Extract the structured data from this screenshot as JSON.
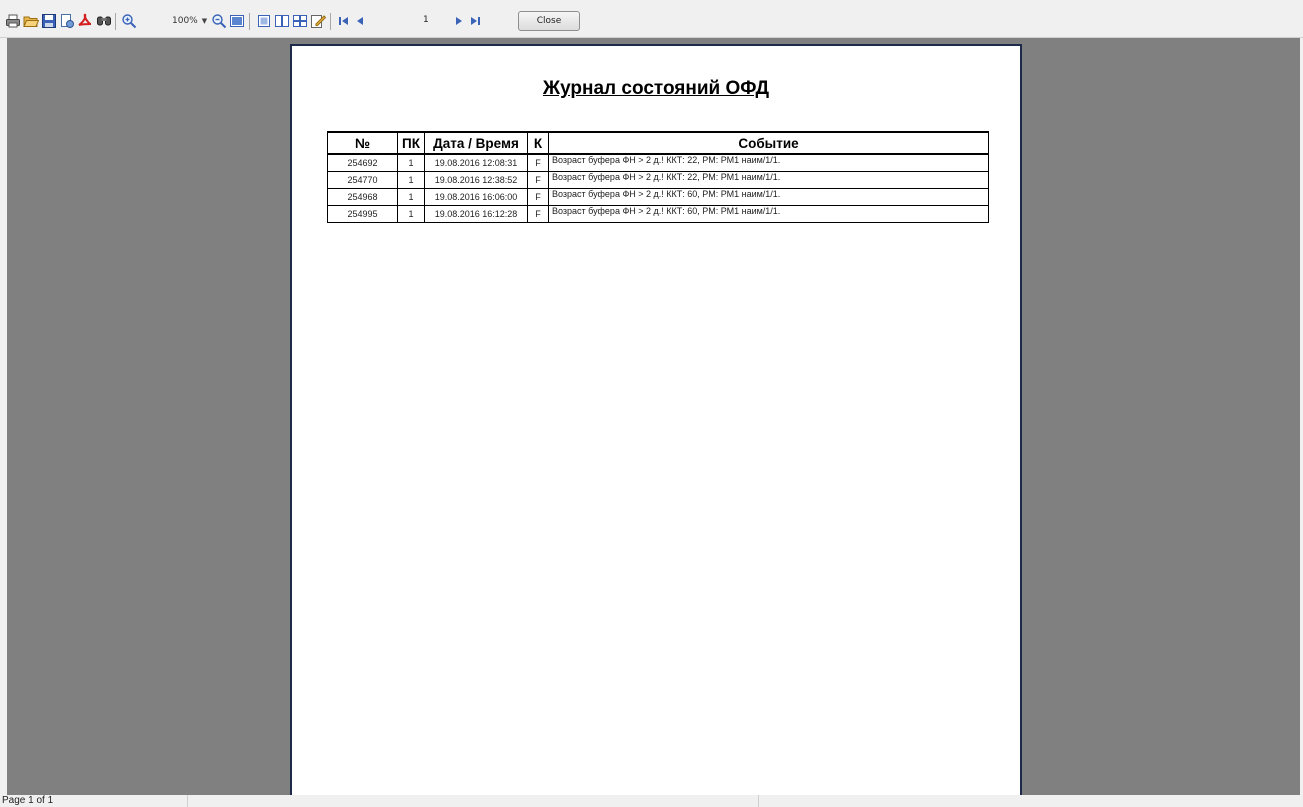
{
  "toolbar": {
    "icons": [
      "print-icon",
      "open-icon",
      "save-icon",
      "page-setup-icon",
      "export-pdf-icon",
      "find-icon",
      "zoom-in-icon",
      "zoom-out-icon",
      "page-width-icon",
      "single-page-icon",
      "two-page-icon",
      "multi-page-icon",
      "edit-icon",
      "first-page-icon",
      "prev-page-icon",
      "next-page-icon",
      "last-page-icon"
    ],
    "zoom": "100%",
    "page_number": "1",
    "close_label": "Close"
  },
  "report": {
    "title": "Журнал состояний ОФД",
    "columns": [
      "№",
      "ПК",
      "Дата / Время",
      "К",
      "Событие"
    ],
    "rows": [
      {
        "num": "254692",
        "pk": "1",
        "datetime": "19.08.2016 12:08:31",
        "k": "F",
        "event": "Возраст буфера ФН > 2 д.! ККТ: 22, РМ: РМ1 наим/1/1."
      },
      {
        "num": "254770",
        "pk": "1",
        "datetime": "19.08.2016 12:38:52",
        "k": "F",
        "event": "Возраст буфера ФН > 2 д.! ККТ: 22, РМ: РМ1 наим/1/1."
      },
      {
        "num": "254968",
        "pk": "1",
        "datetime": "19.08.2016 16:06:00",
        "k": "F",
        "event": "Возраст буфера ФН > 2 д.! ККТ: 60, РМ: РМ1 наим/1/1."
      },
      {
        "num": "254995",
        "pk": "1",
        "datetime": "19.08.2016 16:12:28",
        "k": "F",
        "event": "Возраст буфера ФН > 2 д.! ККТ: 60, РМ: РМ1 наим/1/1."
      }
    ]
  },
  "statusbar": {
    "page_info": "Page 1 of 1"
  }
}
